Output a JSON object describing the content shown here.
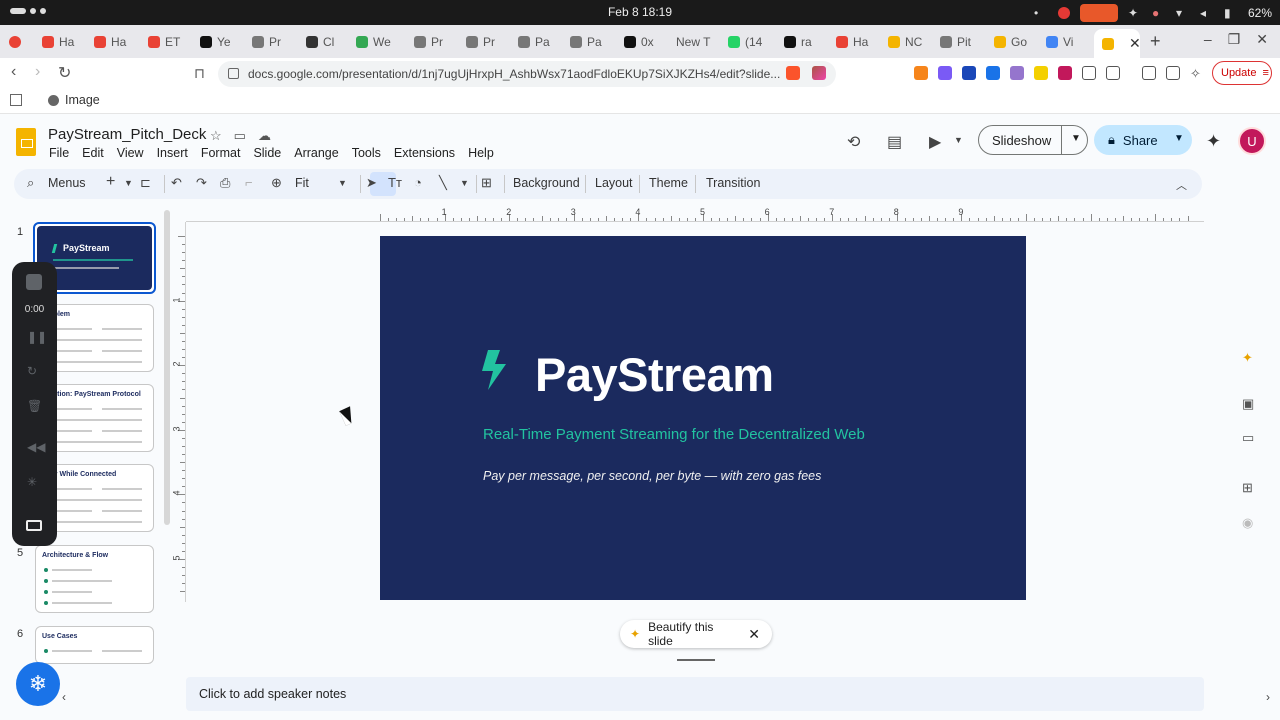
{
  "os": {
    "date_time": "Feb 8  18:19",
    "battery": "62%"
  },
  "browser": {
    "tabs": [
      {
        "label": "Ha",
        "color": "#e94235"
      },
      {
        "label": "Ha",
        "color": "#e94235"
      },
      {
        "label": "ET",
        "color": "#e94235"
      },
      {
        "label": "Ye",
        "color": "#111111"
      },
      {
        "label": "Pr",
        "color": "#777777"
      },
      {
        "label": "Cl",
        "color": "#333333"
      },
      {
        "label": "We",
        "color": "#34a853"
      },
      {
        "label": "Pr",
        "color": "#777777"
      },
      {
        "label": "Pr",
        "color": "#777777"
      },
      {
        "label": "Pa",
        "color": "#777777"
      },
      {
        "label": "Pa",
        "color": "#777777"
      },
      {
        "label": "0x",
        "color": "#111111"
      },
      {
        "label": "New T",
        "color": ""
      },
      {
        "label": "(14",
        "color": "#25d366"
      },
      {
        "label": "ra",
        "color": "#111111"
      },
      {
        "label": "Ha",
        "color": "#e94235"
      },
      {
        "label": "NC",
        "color": "#f4b400"
      },
      {
        "label": "Pit",
        "color": "#777777"
      },
      {
        "label": "Go",
        "color": "#f4b400"
      },
      {
        "label": "Vi",
        "color": "#4285f4"
      }
    ],
    "active_tab_color": "#f4b400",
    "url": "docs.google.com/presentation/d/1nj7ugUjHrxpH_AshbWsx71aodFdloEKUp7SiXJKZHs4/edit?slide...",
    "update_label": "Update",
    "bookmark_label": "Image"
  },
  "doc": {
    "title": "PayStream_Pitch_Deck",
    "menu": [
      "File",
      "Edit",
      "View",
      "Insert",
      "Format",
      "Slide",
      "Arrange",
      "Tools",
      "Extensions",
      "Help"
    ],
    "slideshow_label": "Slideshow",
    "share_label": "Share",
    "avatar_letter": "U"
  },
  "toolbar": {
    "menus_label": "Menus",
    "zoom": "Fit",
    "background": "Background",
    "layout": "Layout",
    "theme": "Theme",
    "transition": "Transition"
  },
  "ruler": {
    "h_labels": [
      "1",
      "2",
      "3",
      "4",
      "5",
      "6",
      "7",
      "8",
      "9"
    ],
    "v_labels": [
      "1",
      "2",
      "3",
      "4",
      "5"
    ]
  },
  "recorder": {
    "time": "0:00"
  },
  "filmstrip": {
    "slides": [
      {
        "number": "1",
        "title": "PayStream"
      },
      {
        "number": "2",
        "title": "Problem"
      },
      {
        "number": "3",
        "title": "Solution: PayStream Protocol"
      },
      {
        "number": "4",
        "title": "Only While Connected"
      },
      {
        "number": "5",
        "title": "Architecture & Flow"
      },
      {
        "number": "6",
        "title": "Use Cases"
      }
    ]
  },
  "slide": {
    "brand": "PayStream",
    "tagline": "Real-Time Payment Streaming for the Decentralized Web",
    "subtitle": "Pay per message, per second, per byte — with zero gas fees",
    "bg_color": "#1b2a5e",
    "accent_color": "#22c3a0"
  },
  "beautify_label": "Beautify this slide",
  "notes_placeholder": "Click to add speaker notes"
}
